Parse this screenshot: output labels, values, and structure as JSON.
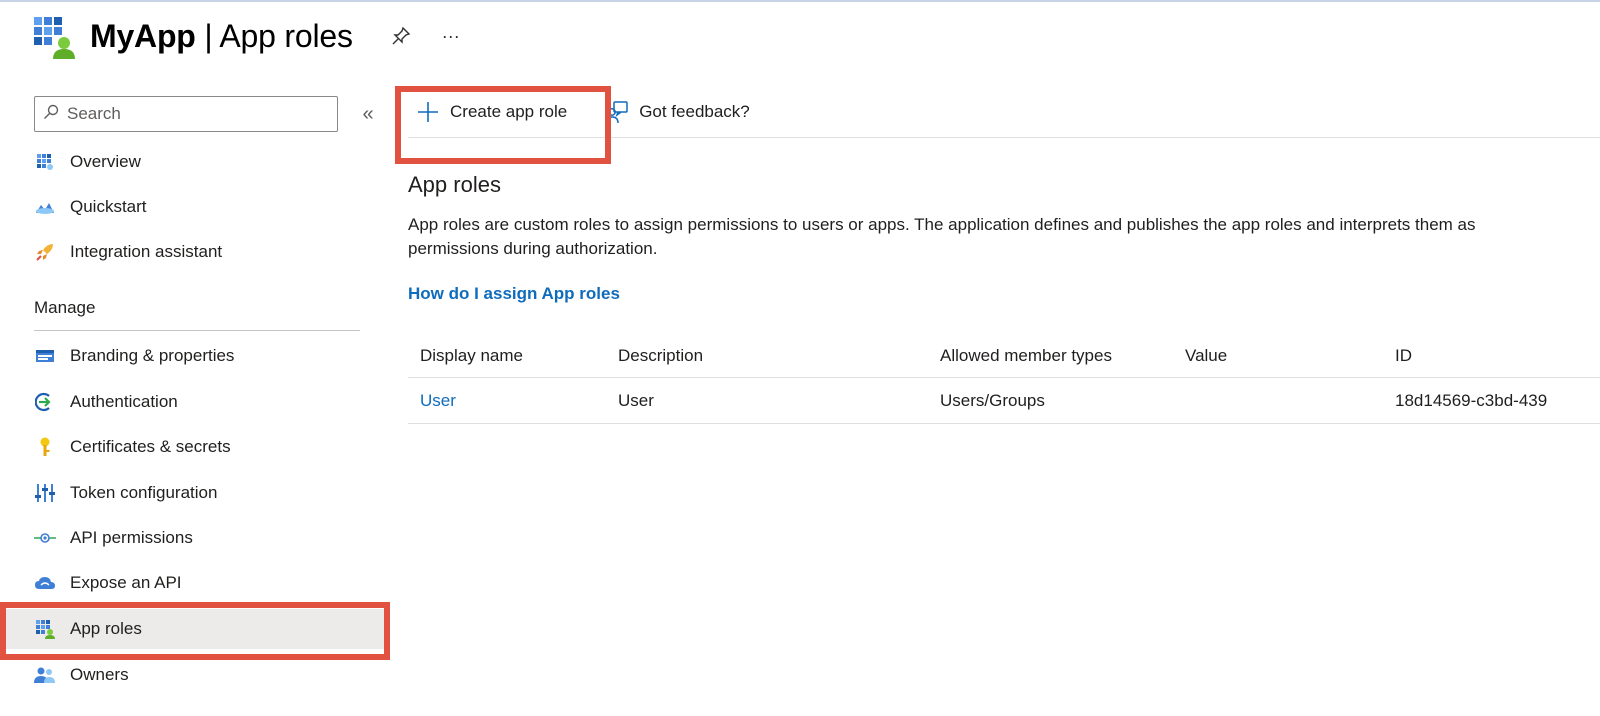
{
  "header": {
    "app_name": "MyApp",
    "separator": " | ",
    "blade_title": "App roles",
    "pin_icon": "pin-icon",
    "more_icon": "more-icon",
    "more_label": "···"
  },
  "sidebar": {
    "search_placeholder": "Search",
    "collapse_label": "«",
    "manage_heading": "Manage",
    "top_items": [
      {
        "label": "Overview",
        "icon": "overview-icon"
      },
      {
        "label": "Quickstart",
        "icon": "quickstart-icon"
      },
      {
        "label": "Integration assistant",
        "icon": "rocket-icon"
      }
    ],
    "manage_items": [
      {
        "label": "Branding & properties",
        "icon": "branding-icon"
      },
      {
        "label": "Authentication",
        "icon": "authentication-icon"
      },
      {
        "label": "Certificates & secrets",
        "icon": "key-icon"
      },
      {
        "label": "Token configuration",
        "icon": "token-config-icon"
      },
      {
        "label": "API permissions",
        "icon": "api-permissions-icon"
      },
      {
        "label": "Expose an API",
        "icon": "cloud-icon"
      },
      {
        "label": "App roles",
        "icon": "app-roles-icon",
        "selected": true
      },
      {
        "label": "Owners",
        "icon": "owners-icon"
      }
    ]
  },
  "toolbar": {
    "create_label": "Create app role",
    "feedback_label": "Got feedback?"
  },
  "main": {
    "title": "App roles",
    "description": "App roles are custom roles to assign permissions to users or apps. The application defines and publishes the app roles and interprets them as permissions during authorization.",
    "help_link": "How do I assign App roles"
  },
  "table": {
    "columns": [
      "Display name",
      "Description",
      "Allowed member types",
      "Value",
      "ID"
    ],
    "rows": [
      {
        "display_name": "User",
        "description": "User",
        "allowed_member_types": "Users/Groups",
        "value": "",
        "id": "18d14569-c3bd-439"
      }
    ]
  },
  "colors": {
    "accent_link": "#0f6cbd",
    "highlight_red": "#e25241",
    "selected_bg": "#edebe9"
  }
}
